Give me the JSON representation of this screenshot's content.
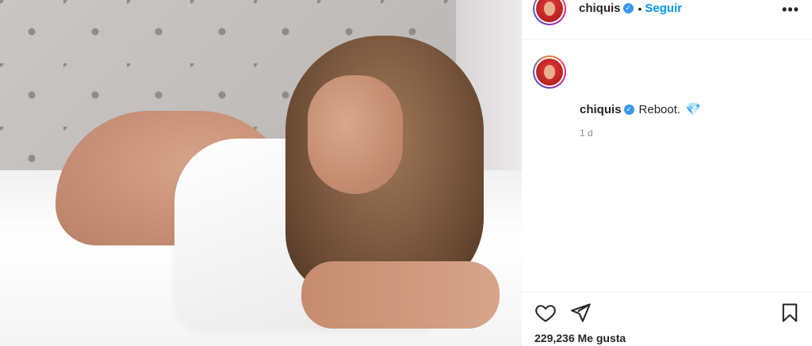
{
  "post": {
    "username": "chiquis",
    "separator": "•",
    "follow_label": "Seguir",
    "more_label": "•••",
    "caption_text": "Reboot.",
    "caption_emoji": "💎",
    "timestamp": "1 d",
    "likes_text": "229,236 Me gusta"
  },
  "icons": {
    "verified": "verified-badge-icon",
    "like": "heart-icon",
    "share": "send-icon",
    "save": "bookmark-icon",
    "more": "more-options-icon"
  },
  "colors": {
    "accent": "#0095f6",
    "verified": "#3897f0",
    "text": "#262626",
    "muted": "#8e8e8e",
    "border": "#efefef"
  }
}
